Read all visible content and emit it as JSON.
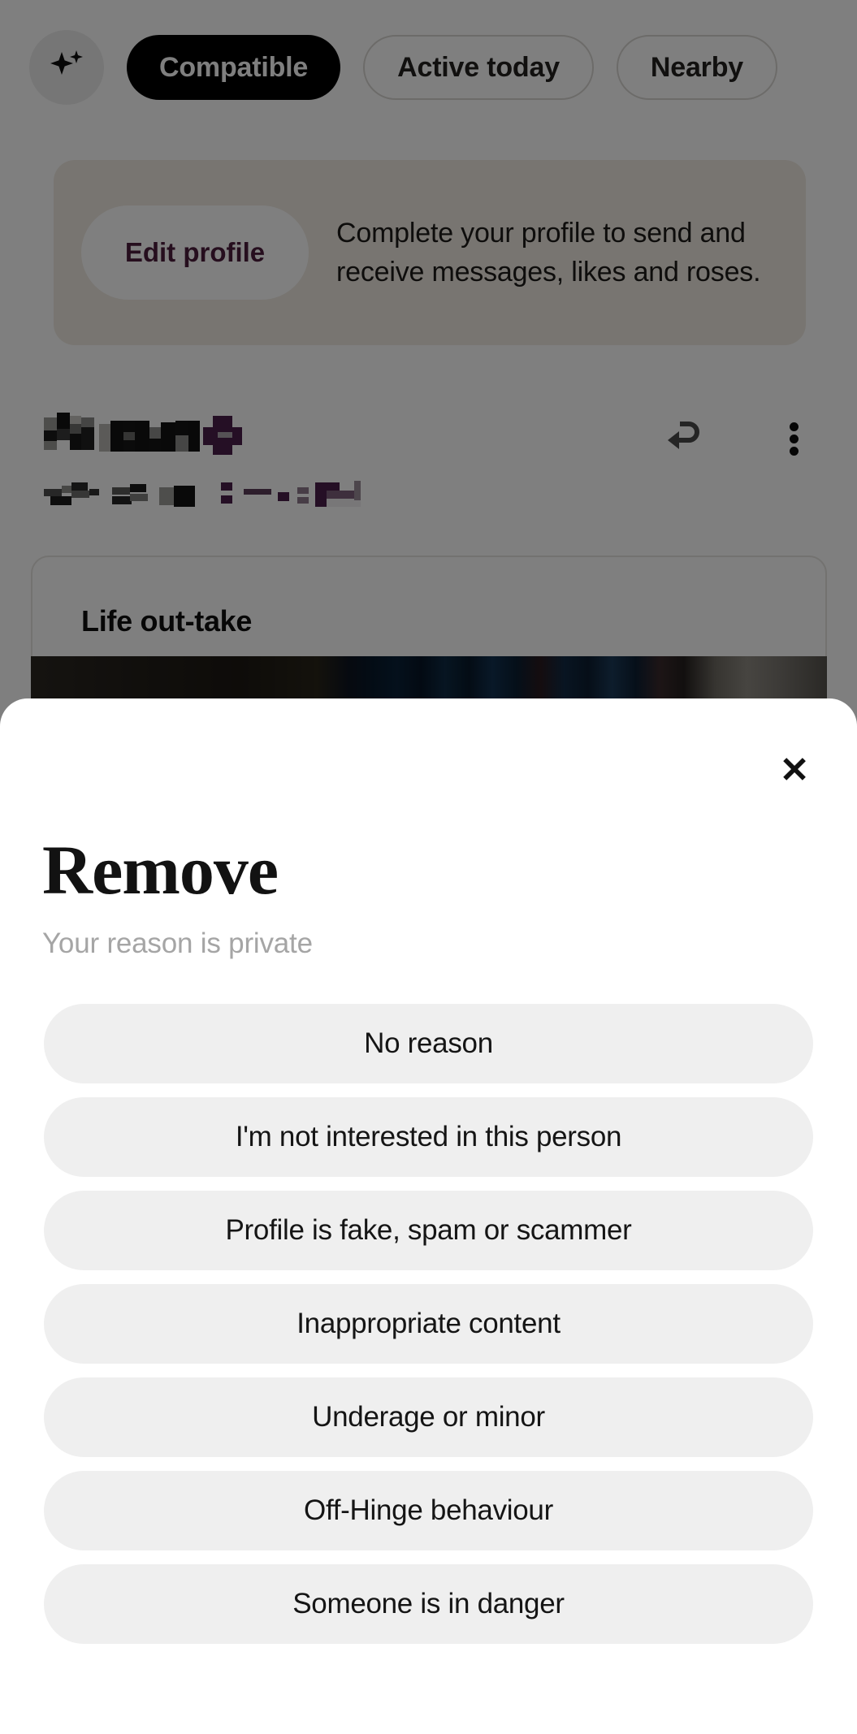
{
  "app": {
    "filter_bar": {
      "sparkle_icon": "sparkle-icon",
      "chips": [
        {
          "label": "Compatible",
          "state": "active"
        },
        {
          "label": "Active today",
          "state": "idle"
        },
        {
          "label": "Nearby",
          "state": "idle"
        }
      ]
    },
    "profile_banner": {
      "button_label": "Edit profile",
      "message": "Complete your profile to send and receive messages, likes and roses."
    },
    "profile_row": {
      "name": "",
      "subtitle": "",
      "redacted": "true",
      "actions": [
        {
          "icon": "undo-arrow-icon"
        },
        {
          "icon": "more-vertical-icon"
        }
      ]
    },
    "prompt_card": {
      "title": "Life out-take"
    }
  },
  "remove_sheet": {
    "close_icon": "close-icon",
    "title": "Remove",
    "subtitle": "Your reason is private",
    "options": [
      "No reason",
      "I'm not interested in this person",
      "Profile is fake, spam or scammer",
      "Inappropriate content",
      "Underage or minor",
      "Off-Hinge behaviour",
      "Someone is in danger"
    ]
  },
  "colors": {
    "accent_dark": "#000000",
    "banner_bg": "#f0ebe3",
    "edit_profile_text": "#4c1d3d",
    "option_bg": "#efefef",
    "subtitle_gray": "#a5a5a5",
    "scrim": "rgba(0,0,0,0.50)"
  }
}
